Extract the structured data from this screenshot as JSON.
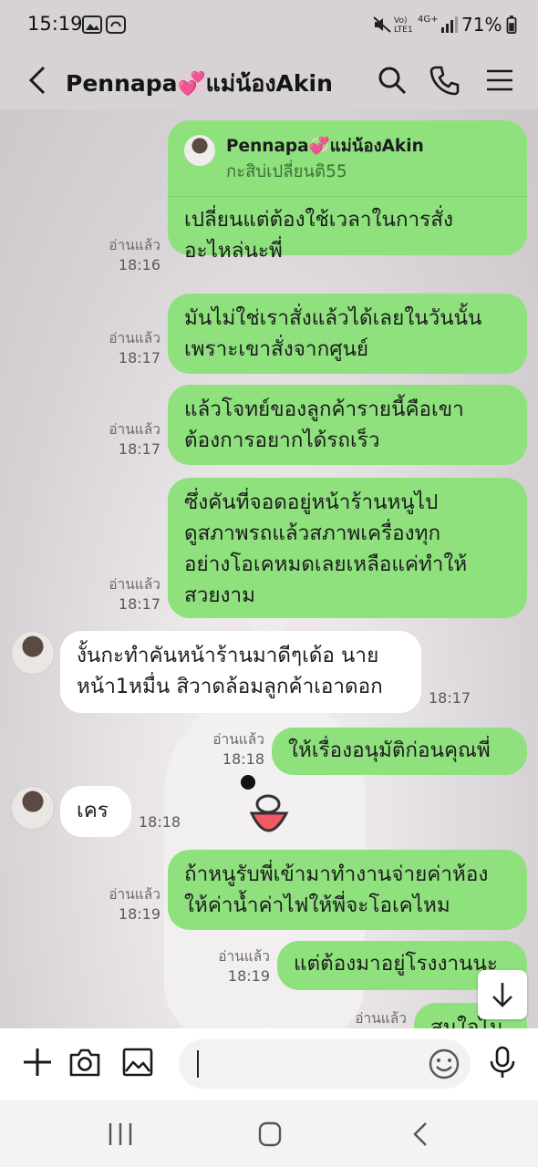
{
  "status": {
    "time": "15:19",
    "battery": "71%",
    "network": "4G+",
    "volte": "Vo) LTE1"
  },
  "header": {
    "title": "Pennapa💞แม่น้องAkin"
  },
  "reply_preview": {
    "name": "Pennapa💞แม่น้องAkin",
    "text": "กะสิบ่เปลี่ยนติ55"
  },
  "messages": [
    {
      "dir": "out",
      "lines": [
        "เปลี่ยนแต่ต้องใช้เวลาในการสั่ง",
        "อะไหล่นะพี่"
      ],
      "read": "อ่านแล้ว",
      "time": "18:16"
    },
    {
      "dir": "out",
      "lines": [
        "มันไม่ใช่เราสั่งแล้วได้เลยในวันนั้น",
        "เพราะเขาสั่งจากศูนย์"
      ],
      "read": "อ่านแล้ว",
      "time": "18:17"
    },
    {
      "dir": "out",
      "lines": [
        "แล้วโจทย์ของลูกค้ารายนี้คือเขา",
        "ต้องการอยากได้รถเร็ว"
      ],
      "read": "อ่านแล้ว",
      "time": "18:17"
    },
    {
      "dir": "out",
      "lines": [
        "ซึ่งคันที่จอดอยู่หน้าร้านหนูไป",
        "ดูสภาพรถแล้วสภาพเครื่องทุก",
        "อย่างโอเคหมดเลยเหลือแค่ทำให้",
        "สวยงาม"
      ],
      "read": "อ่านแล้ว",
      "time": "18:17"
    },
    {
      "dir": "in",
      "lines": [
        "งั้นกะทำคันหน้าร้านมาดีๆเด้อ นาย",
        "หน้า1หมื่น สิวาดล้อมลูกค้าเอาดอก"
      ],
      "time": "18:17"
    },
    {
      "dir": "out",
      "lines": [
        "ให้เรื่องอนุมัติก่อนคุณพี่"
      ],
      "read": "อ่านแล้ว",
      "time": "18:18"
    },
    {
      "dir": "in",
      "lines": [
        "เคร"
      ],
      "time": "18:18"
    },
    {
      "dir": "out",
      "lines": [
        "ถ้าหนูรับพี่เข้ามาทำงานจ่ายค่าห้อง",
        "ให้ค่าน้ำค่าไฟให้พี่จะโอเคไหม"
      ],
      "read": "อ่านแล้ว",
      "time": "18:19"
    },
    {
      "dir": "out",
      "lines": [
        "แต่ต้องมาอยู่โรงงานนะ"
      ],
      "read": "อ่านแล้ว",
      "time": "18:19"
    },
    {
      "dir": "out",
      "lines": [
        "สนใจไม"
      ],
      "read": "อ่านแล้ว",
      "time": ""
    }
  ],
  "input": {
    "placeholder": ""
  },
  "icons": {
    "back": "back-arrow-icon",
    "search": "search-icon",
    "call": "phone-icon",
    "menu": "menu-icon",
    "plus": "plus-icon",
    "camera": "camera-icon",
    "image": "image-icon",
    "emoji": "emoji-icon",
    "mic": "microphone-icon",
    "scroll": "arrow-down-icon"
  },
  "colors": {
    "outgoing_bubble": "#8fe17e",
    "incoming_bubble": "#ffffff",
    "header_bg": "#d7d3d5"
  }
}
